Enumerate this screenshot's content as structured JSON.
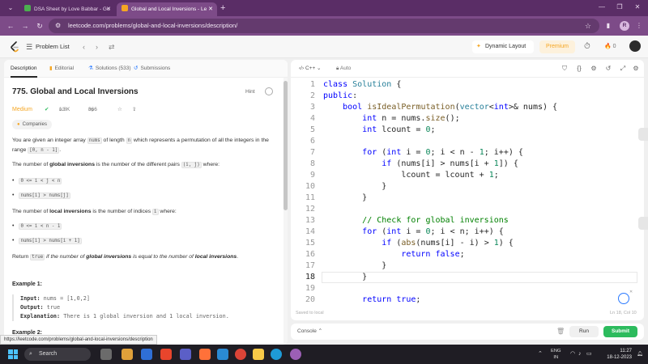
{
  "browser": {
    "tabs": [
      {
        "title": "DSA Sheet by Love Babbar - Go",
        "favicon_color": "#4caf50"
      },
      {
        "title": "Global and Local Inversions - Le",
        "favicon_color": "#f5a623"
      }
    ],
    "url": "leetcode.com/problems/global-and-local-inversions/description/",
    "profile_initial": "R",
    "status_url": "https://leetcode.com/problems/global-and-local-inversions/description"
  },
  "lc_header": {
    "problem_list": "Problem List",
    "dynamic_layout": "Dynamic Layout",
    "premium": "Premium",
    "streak": "0"
  },
  "left": {
    "tabs": [
      {
        "label": "Description",
        "icon": "doc-icon"
      },
      {
        "label": "Editorial",
        "icon": "book-icon"
      },
      {
        "label": "Solutions (533)",
        "icon": "flask-icon"
      },
      {
        "label": "Submissions",
        "icon": "history-icon"
      }
    ],
    "title": "775. Global and Local Inversions",
    "hint": "Hint",
    "difficulty": "Medium",
    "likes": "1.8K",
    "dislikes": "366",
    "companies": "Companies",
    "desc1_a": "You are given an integer array ",
    "desc1_code1": "nums",
    "desc1_b": " of length ",
    "desc1_code2": "n",
    "desc1_c": " which represents a permutation of all the integers in the range ",
    "desc1_code3": "[0, n - 1]",
    "desc1_d": ".",
    "global_a": "The number of ",
    "global_b": "global inversions",
    "global_c": " is the number of the different pairs ",
    "global_code": "(i, j)",
    "global_d": " where:",
    "g_bullet1": "0 <= i < j < n",
    "g_bullet2": "nums[i] > nums[j]",
    "local_a": "The number of ",
    "local_b": "local inversions",
    "local_c": " is the number of indices ",
    "local_code": "i",
    "local_d": " where:",
    "l_bullet1": "0 <= i < n - 1",
    "l_bullet2": "nums[i] > nums[i + 1]",
    "ret_a": "Return ",
    "ret_code": "true",
    "ret_b": " if the number of ",
    "ret_c": "global inversions",
    "ret_d": " is equal to the number of ",
    "ret_e": "local inversions",
    "ret_f": ".",
    "example1_title": "Example 1:",
    "ex_input_lbl": "Input:",
    "ex_input_val": " nums = [1,0,2]",
    "ex_output_lbl": "Output:",
    "ex_output_val": " true",
    "ex_expl_lbl": "Explanation:",
    "ex_expl_val": " There is 1 global inversion and 1 local inversion.",
    "example2_title": "Example 2:"
  },
  "editor": {
    "language": "C++",
    "auto": "Auto",
    "saved": "Saved to local",
    "position": "Ln 18, Col 10",
    "lines": [
      {
        "n": "1",
        "html": "<span class='kw'>class</span> <span class='ty'>Solution</span> {"
      },
      {
        "n": "2",
        "html": "<span class='kw'>public</span>:"
      },
      {
        "n": "3",
        "html": "    <span class='kw'>bool</span> <span class='fn'>isIdealPermutation</span>(<span class='ty'>vector</span>&lt;<span class='kw'>int</span>&gt;&amp; nums) {"
      },
      {
        "n": "4",
        "html": "        <span class='kw'>int</span> n = nums.<span class='fn'>size</span>();"
      },
      {
        "n": "5",
        "html": "        <span class='kw'>int</span> lcount = <span class='nm'>0</span>;"
      },
      {
        "n": "6",
        "html": ""
      },
      {
        "n": "7",
        "html": "        <span class='kw'>for</span> (<span class='kw'>int</span> i = <span class='nm'>0</span>; i &lt; n - <span class='nm'>1</span>; i++) {"
      },
      {
        "n": "8",
        "html": "            <span class='kw'>if</span> (nums[i] &gt; nums[i + <span class='nm'>1</span>]) {"
      },
      {
        "n": "9",
        "html": "                lcount = lcount + <span class='nm'>1</span>;"
      },
      {
        "n": "10",
        "html": "            }"
      },
      {
        "n": "11",
        "html": "        }"
      },
      {
        "n": "12",
        "html": ""
      },
      {
        "n": "13",
        "html": "        <span class='cm'>// Check for global inversions</span>"
      },
      {
        "n": "14",
        "html": "        <span class='kw'>for</span> (<span class='kw'>int</span> i = <span class='nm'>0</span>; i &lt; n; i++) {"
      },
      {
        "n": "15",
        "html": "            <span class='kw'>if</span> (<span class='fn'>abs</span>(nums[i] - i) &gt; <span class='nm'>1</span>) {"
      },
      {
        "n": "16",
        "html": "                <span class='kw'>return</span> <span class='kw'>false</span>;"
      },
      {
        "n": "17",
        "html": "            }"
      },
      {
        "n": "18",
        "html": "        }"
      },
      {
        "n": "19",
        "html": ""
      },
      {
        "n": "20",
        "html": "        <span class='kw'>return</span> <span class='kw'>true</span>;"
      }
    ],
    "active_line": "18"
  },
  "console": {
    "label": "Console",
    "run": "Run",
    "submit": "Submit"
  },
  "taskbar": {
    "search": "Search",
    "lang_top": "ENG",
    "lang_bottom": "IN",
    "time": "11:27",
    "date": "18-12-2023"
  }
}
